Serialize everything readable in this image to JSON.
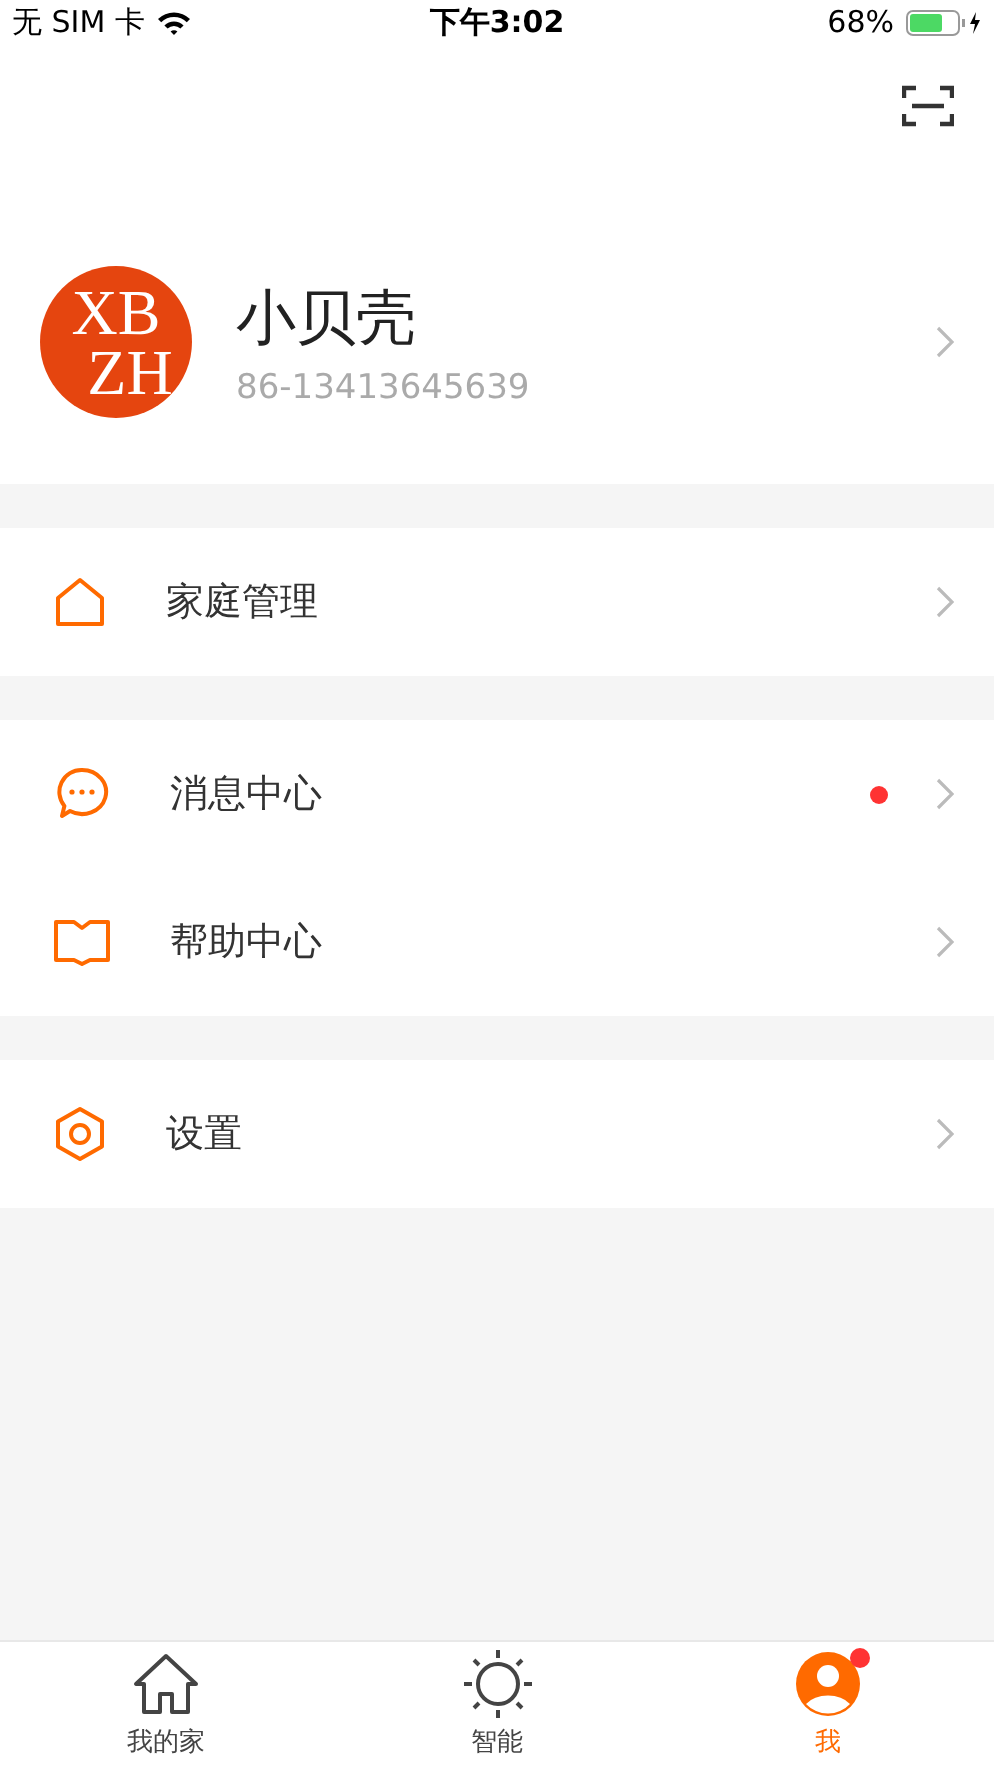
{
  "status_bar": {
    "carrier": "无 SIM 卡",
    "time": "下午3:02",
    "battery": "68%"
  },
  "profile": {
    "avatar_lines": [
      "XB",
      "ZH"
    ],
    "name": "小贝壳",
    "phone": "86-13413645639"
  },
  "groups": [
    {
      "items": [
        {
          "kind": "home",
          "label": "家庭管理",
          "badge": false
        }
      ]
    },
    {
      "items": [
        {
          "kind": "message",
          "label": "消息中心",
          "badge": true
        },
        {
          "kind": "help",
          "label": "帮助中心",
          "badge": false
        }
      ]
    },
    {
      "items": [
        {
          "kind": "settings",
          "label": "设置",
          "badge": false
        }
      ]
    }
  ],
  "tabs": [
    {
      "kind": "home",
      "label": "我的家",
      "selected": false,
      "badge": false
    },
    {
      "kind": "smart",
      "label": "智能",
      "selected": false,
      "badge": false
    },
    {
      "kind": "me",
      "label": "我",
      "selected": true,
      "badge": true
    }
  ]
}
